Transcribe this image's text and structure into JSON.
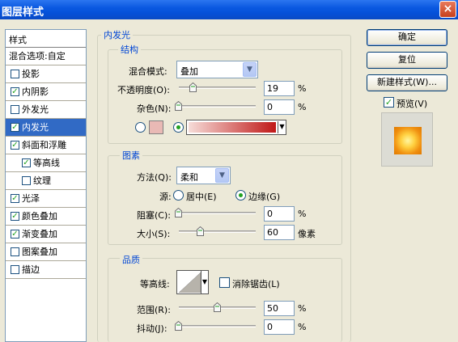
{
  "window": {
    "title": "图层样式",
    "close_glyph": "×"
  },
  "style_list": {
    "header": "样式",
    "blend_options": "混合选项:自定",
    "items": [
      {
        "label": "投影",
        "checked": false
      },
      {
        "label": "内阴影",
        "checked": true
      },
      {
        "label": "外发光",
        "checked": false
      },
      {
        "label": "内发光",
        "checked": true,
        "selected": true
      },
      {
        "label": "斜面和浮雕",
        "checked": true
      },
      {
        "label": "等高线",
        "checked": true,
        "indent": true
      },
      {
        "label": "纹理",
        "checked": false,
        "indent": true
      },
      {
        "label": "光泽",
        "checked": true
      },
      {
        "label": "颜色叠加",
        "checked": true
      },
      {
        "label": "渐变叠加",
        "checked": true
      },
      {
        "label": "图案叠加",
        "checked": false
      },
      {
        "label": "描边",
        "checked": false
      }
    ]
  },
  "panel": {
    "section_title": "内发光",
    "structure": {
      "title": "结构",
      "blend_mode_label": "混合模式:",
      "blend_mode_value": "叠加",
      "opacity_label": "不透明度(O):",
      "opacity_value": "19",
      "opacity_unit": "%",
      "noise_label": "杂色(N):",
      "noise_value": "0",
      "noise_unit": "%",
      "color_swatch": "#e9b9b5",
      "gradient_start": "#f6dcd8",
      "gradient_end": "#c01818",
      "gradient_mode": "gradient"
    },
    "elements": {
      "title": "图素",
      "method_label": "方法(Q):",
      "method_value": "柔和",
      "source_label": "源:",
      "source_center": "居中(E)",
      "source_edge": "边缘(G)",
      "source_selected": "edge",
      "choke_label": "阻塞(C):",
      "choke_value": "0",
      "choke_unit": "%",
      "size_label": "大小(S):",
      "size_value": "60",
      "size_unit": "像素"
    },
    "quality": {
      "title": "品质",
      "contour_label": "等高线:",
      "anti_alias_label": "消除锯齿(L)",
      "anti_alias_checked": false,
      "range_label": "范围(R):",
      "range_value": "50",
      "range_unit": "%",
      "jitter_label": "抖动(J):",
      "jitter_value": "0",
      "jitter_unit": "%"
    }
  },
  "actions": {
    "ok": "确定",
    "reset": "复位",
    "new_style": "新建样式(W)...",
    "preview_label": "预览(V)",
    "preview_checked": true
  },
  "colors": {
    "titlebar": "#0a58e0",
    "selection": "#316ac5",
    "group_title": "#0046d5",
    "check": "#21a121"
  }
}
